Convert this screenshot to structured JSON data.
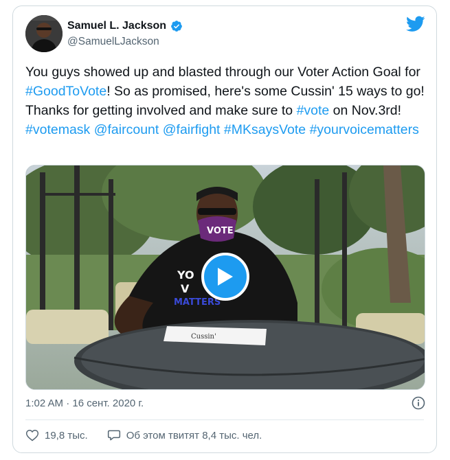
{
  "author": {
    "name": "Samuel L. Jackson",
    "handle": "@SamuelLJackson",
    "verified": true
  },
  "tweet": {
    "segments": [
      {
        "text": "You guys showed up and blasted through our Voter Action Goal for ",
        "link": false
      },
      {
        "text": "#GoodToVote",
        "link": true
      },
      {
        "text": "! So as promised, here's some Cussin' 15 ways to go!  Thanks for getting involved and make sure to ",
        "link": false
      },
      {
        "text": "#vote",
        "link": true
      },
      {
        "text": " on Nov.3rd! ",
        "link": false
      },
      {
        "text": "#votemask",
        "link": true
      },
      {
        "text": " ",
        "link": false
      },
      {
        "text": "@faircount",
        "link": true
      },
      {
        "text": " ",
        "link": false
      },
      {
        "text": "@fairfight",
        "link": true
      },
      {
        "text": " ",
        "link": false
      },
      {
        "text": "#MKsaysVote",
        "link": true
      },
      {
        "text": " ",
        "link": false
      },
      {
        "text": "#yourvoicematters",
        "link": true
      }
    ]
  },
  "media": {
    "type": "video",
    "mask_text": "VOTE",
    "shirt_lines": [
      "YO",
      "V",
      "MATTERS"
    ],
    "card_text": "Cussin'"
  },
  "timestamp": "1:02 AM · 16 сент. 2020 г.",
  "stats": {
    "likes": "19,8 тыс.",
    "discussion": "Об этом твитят 8,4 тыс. чел."
  },
  "colors": {
    "accent": "#1d9bf0",
    "text": "#0f1419",
    "muted": "#536471",
    "border": "#cfd9de"
  },
  "icons": {
    "logo": "twitter-bird-icon",
    "verified": "verified-badge-icon",
    "play": "play-icon",
    "info": "info-icon",
    "like": "heart-icon",
    "reply": "speech-bubble-icon"
  }
}
